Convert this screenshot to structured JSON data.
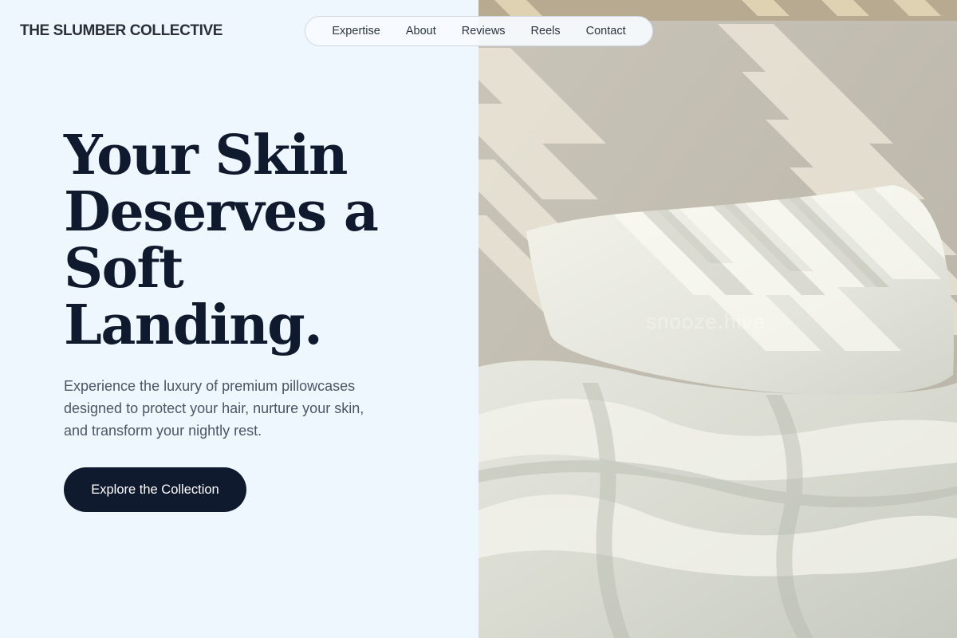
{
  "brand": {
    "name": "THE SLUMBER COLLECTIVE"
  },
  "nav": {
    "items": [
      {
        "label": "Expertise"
      },
      {
        "label": "About"
      },
      {
        "label": "Reviews"
      },
      {
        "label": "Reels"
      },
      {
        "label": "Contact"
      }
    ]
  },
  "hero": {
    "headline_lines": [
      "Your Skin",
      "Deserves a",
      "Soft",
      "Landing."
    ],
    "subtext_lines": [
      "Experience the luxury of premium pillowcases",
      "designed to protect your hair, nurture your skin,",
      "and transform your nightly rest."
    ],
    "cta_label": "Explore the Collection",
    "image_watermark": "snooze.hive"
  },
  "colors": {
    "background": "#eff7fe",
    "headline": "#0f1a2e",
    "body_text": "#4a5566",
    "cta_background": "#101a2e",
    "cta_text": "#ffffff"
  }
}
